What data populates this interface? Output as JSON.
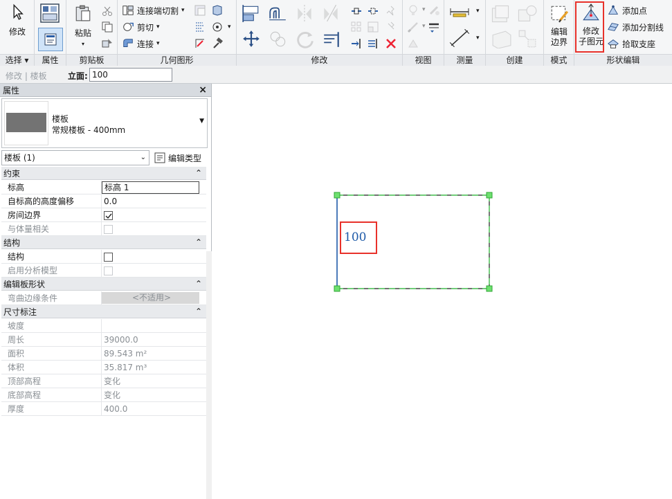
{
  "ribbon": {
    "select": {
      "modify": "修改",
      "label": "选择 ▾"
    },
    "properties": {
      "label": "属性"
    },
    "clipboard": {
      "paste": "粘贴",
      "label": "剪贴板"
    },
    "geometry": {
      "join_cut": "连接端切割",
      "cut": "剪切",
      "join": "连接",
      "label": "几何图形"
    },
    "modify": {
      "label": "修改"
    },
    "view": {
      "label": "视图"
    },
    "measure": {
      "label": "测量"
    },
    "create": {
      "label": "创建"
    },
    "mode": {
      "edit_boundary": "编辑\n边界",
      "label": "模式"
    },
    "shape_edit": {
      "modify_sub": "修改\n子图元",
      "add_point": "添加点",
      "add_split_line": "添加分割线",
      "pick_support": "拾取支座",
      "label": "形状编辑"
    }
  },
  "optbar": {
    "context": "修改 | 楼板",
    "elevation_label": "立面:",
    "elevation_value": "100"
  },
  "properties": {
    "title": "属性",
    "close": "×",
    "type_name": "楼板",
    "type_detail": "常规楼板 - 400mm",
    "selector": "楼板 (1)",
    "edit_type": "编辑类型",
    "groups": {
      "constraints": "约束",
      "structure": "结构",
      "edit_slab_shape": "编辑板形状",
      "dimensions": "尺寸标注"
    },
    "rows": {
      "level_k": "标高",
      "level_v": "标高 1",
      "offset_k": "自标高的高度偏移",
      "offset_v": "0.0",
      "room_k": "房间边界",
      "mass_k": "与体量相关",
      "struct_k": "结构",
      "analytic_k": "启用分析模型",
      "curved_k": "弯曲边缘条件",
      "curved_v": "<不适用>",
      "slope_k": "坡度",
      "slope_v": "",
      "perim_k": "周长",
      "perim_v": "39000.0",
      "area_k": "面积",
      "area_v": "89.543 m²",
      "vol_k": "体积",
      "vol_v": "35.817 m³",
      "top_k": "顶部高程",
      "top_v": "变化",
      "bot_k": "底部高程",
      "bot_v": "变化",
      "thick_k": "厚度",
      "thick_v": "400.0"
    }
  },
  "canvas": {
    "elevation_label": "100"
  },
  "colors": {
    "highlight": "#e8312a",
    "accent": "#1e5aa8",
    "handle": "#3fd14a",
    "dash": "#2fbf3a"
  }
}
